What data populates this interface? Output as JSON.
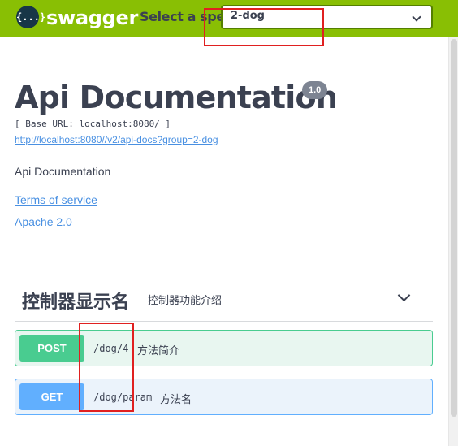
{
  "topbar": {
    "logo_icon": "swagger-logo-icon",
    "logo_glyph": "{...}",
    "brand": "swagger",
    "spec_label": "Select a spec",
    "spec_selected": "2-dog",
    "bar_color": "#89bf04"
  },
  "info": {
    "title": "Api Documentation",
    "version": "1.0",
    "base_url": "[ Base URL: localhost:8080/ ]",
    "docs_link": "http://localhost:8080//v2/api-docs?group=2-dog",
    "description": "Api Documentation",
    "terms": "Terms of service",
    "license": "Apache 2.0"
  },
  "tag": {
    "name": "控制器显示名",
    "description": "控制器功能介绍",
    "expand_icon": "chevron-down-icon"
  },
  "operations": [
    {
      "method": "POST",
      "path": "/dog/4",
      "summary": "方法简介",
      "color": "#49cc90"
    },
    {
      "method": "GET",
      "path": "/dog/param",
      "summary": "方法名",
      "color": "#61affe"
    }
  ],
  "colors": {
    "link": "#4990e2",
    "annotation": "#e02020"
  }
}
